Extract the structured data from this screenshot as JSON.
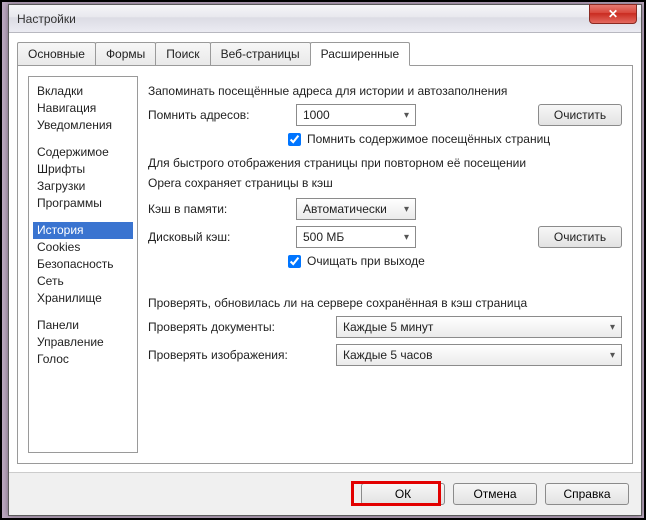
{
  "window": {
    "title": "Настройки"
  },
  "tabs": {
    "list": [
      "Основные",
      "Формы",
      "Поиск",
      "Веб-страницы",
      "Расширенные"
    ],
    "active": 4
  },
  "sidebar": {
    "groups": [
      [
        "Вкладки",
        "Навигация",
        "Уведомления"
      ],
      [
        "Содержимое",
        "Шрифты",
        "Загрузки",
        "Программы"
      ],
      [
        "История",
        "Cookies",
        "Безопасность",
        "Сеть",
        "Хранилище"
      ],
      [
        "Панели",
        "Управление",
        "Голос"
      ]
    ],
    "selected": "История"
  },
  "main": {
    "section1_text": "Запоминать посещённые адреса для истории и автозаполнения",
    "remember_addr_label": "Помнить адресов:",
    "remember_addr_value": "1000",
    "clear1_label": "Очистить",
    "remember_content_label": "Помнить содержимое посещённых страниц",
    "remember_content_checked": true,
    "section2_line1": "Для быстрого отображения страницы при повторном её посещении",
    "section2_line2": "Opera сохраняет страницы в кэш",
    "mem_cache_label": "Кэш в памяти:",
    "mem_cache_value": "Автоматически",
    "disk_cache_label": "Дисковый кэш:",
    "disk_cache_value": "500 МБ",
    "clear2_label": "Очистить",
    "clear_on_exit_label": "Очищать при выходе",
    "clear_on_exit_checked": true,
    "section3_text": "Проверять, обновилась ли на сервере сохранённая в кэш страница",
    "check_docs_label": "Проверять документы:",
    "check_docs_value": "Каждые 5 минут",
    "check_imgs_label": "Проверять изображения:",
    "check_imgs_value": "Каждые 5 часов"
  },
  "buttons": {
    "ok": "ОК",
    "cancel": "Отмена",
    "help": "Справка"
  }
}
